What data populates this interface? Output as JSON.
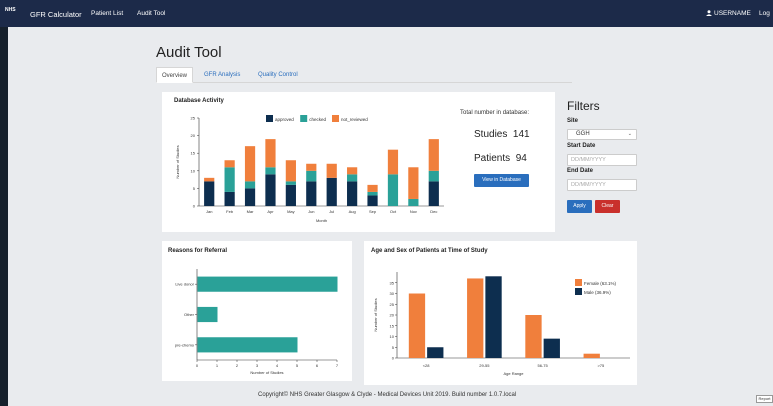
{
  "navbar": {
    "logo_text": "NHS",
    "brand": "GFR Calculator",
    "links": [
      "Patient List",
      "Audit Tool"
    ],
    "username": "USERNAME",
    "logout": "Log"
  },
  "page": {
    "title": "Audit Tool",
    "tabs": [
      "Overview",
      "GFR Analysis",
      "Quality Control"
    ]
  },
  "database_activity": {
    "title": "Database Activity",
    "chart_data": {
      "type": "bar",
      "stacked": true,
      "categories": [
        "Jan",
        "Feb",
        "Mar",
        "Apr",
        "May",
        "Jun",
        "Jul",
        "Aug",
        "Sep",
        "Oct",
        "Nov",
        "Dec"
      ],
      "series": [
        {
          "name": "approved",
          "color": "#0d2e4f",
          "values": [
            7,
            4,
            5,
            9,
            6,
            7,
            8,
            7,
            3,
            0,
            0,
            7
          ]
        },
        {
          "name": "checked",
          "color": "#2aa198",
          "values": [
            0,
            7,
            2,
            2,
            1,
            3,
            0,
            2,
            1,
            9,
            2,
            3
          ]
        },
        {
          "name": "not_reviewed",
          "color": "#f07f3c",
          "values": [
            1,
            2,
            10,
            8,
            6,
            2,
            4,
            2,
            2,
            7,
            9,
            9
          ]
        }
      ],
      "xlabel": "Month",
      "ylabel": "Number of Studies",
      "ylim": [
        0,
        25
      ],
      "yticks": [
        0,
        5,
        10,
        15,
        20,
        25
      ],
      "legend": "top-center"
    }
  },
  "totals": {
    "label": "Total number in database:",
    "studies_label": "Studies",
    "studies_value": "141",
    "patients_label": "Patients",
    "patients_value": "94",
    "view_button": "View in Database"
  },
  "filters": {
    "title": "Filters",
    "site_label": "Site",
    "site_value": "GGH",
    "start_label": "Start Date",
    "start_placeholder": "DD/MM/YYYY",
    "end_label": "End Date",
    "end_placeholder": "DD/MM/YYYY",
    "apply": "Apply",
    "clear": "Clear"
  },
  "referral": {
    "title": "Reasons for Referral",
    "chart_data": {
      "type": "bar",
      "orientation": "horizontal",
      "categories": [
        "Live donor",
        "Other",
        "pre-chemo"
      ],
      "values": [
        7,
        1,
        5
      ],
      "color": "#2aa198",
      "xlabel": "Number of Studies",
      "xlim": [
        0,
        7
      ],
      "xticks": [
        0,
        1,
        2,
        3,
        4,
        5,
        6,
        7
      ]
    }
  },
  "age_sex": {
    "title": "Age and Sex of Patients at Time of Study",
    "chart_data": {
      "type": "bar",
      "categories": [
        "<28",
        "29-55",
        "56-75",
        ">75"
      ],
      "series": [
        {
          "name": "Female (63.1%)",
          "color": "#f07f3c",
          "values": [
            30,
            37,
            20,
            2
          ]
        },
        {
          "name": "Male (36.9%)",
          "color": "#0d2e4f",
          "values": [
            5,
            38,
            9,
            0
          ]
        }
      ],
      "xlabel": "Age Range",
      "ylabel": "Number of Studies",
      "ylim": [
        0,
        40
      ],
      "yticks": [
        0,
        5,
        10,
        15,
        20,
        25,
        30,
        35
      ],
      "legend": "top-right"
    }
  },
  "footer": {
    "text": "Copyright© NHS Greater Glasgow & Clyde - Medical Devices Unit 2019. Build number 1.0.7.local",
    "report": "Report"
  }
}
